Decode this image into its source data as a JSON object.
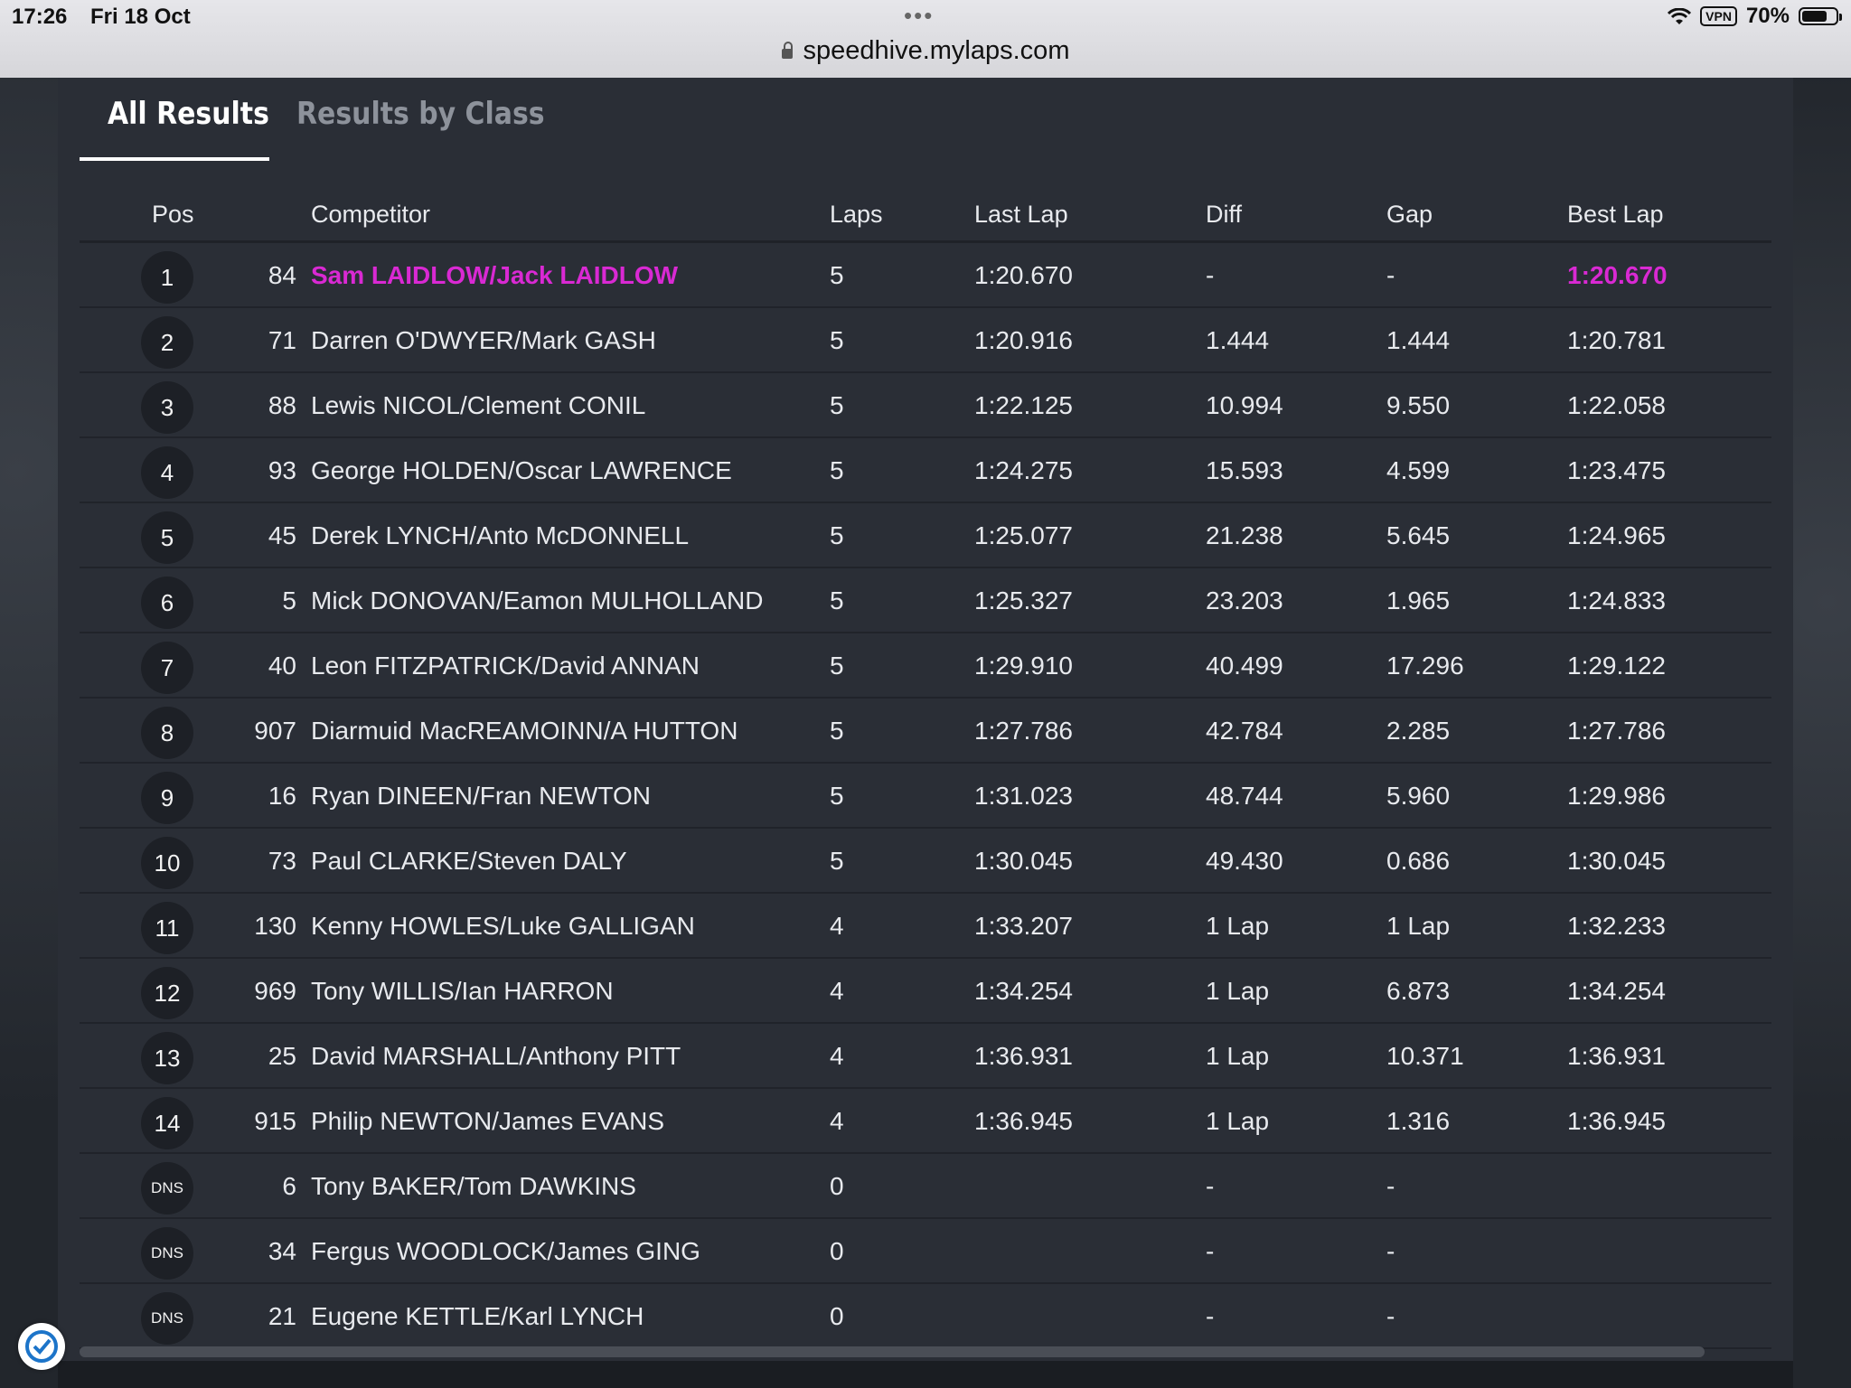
{
  "status_bar": {
    "time": "17:26",
    "date": "Fri 18 Oct",
    "url": "speedhive.mylaps.com",
    "vpn": "VPN",
    "battery": "70%"
  },
  "tabs": [
    {
      "label": "All Results",
      "active": true
    },
    {
      "label": "Results by Class",
      "active": false
    }
  ],
  "table": {
    "headers": {
      "pos": "Pos",
      "competitor": "Competitor",
      "laps": "Laps",
      "last_lap": "Last Lap",
      "diff": "Diff",
      "gap": "Gap",
      "best_lap": "Best Lap"
    },
    "highlight_color": "#d929d3",
    "rows": [
      {
        "pos": "1",
        "num": "84",
        "competitor": "Sam LAIDLOW/Jack LAIDLOW",
        "laps": "5",
        "last": "1:20.670",
        "diff": "-",
        "gap": "-",
        "best": "1:20.670",
        "highlight": true
      },
      {
        "pos": "2",
        "num": "71",
        "competitor": "Darren O'DWYER/Mark GASH",
        "laps": "5",
        "last": "1:20.916",
        "diff": "1.444",
        "gap": "1.444",
        "best": "1:20.781"
      },
      {
        "pos": "3",
        "num": "88",
        "competitor": "Lewis NICOL/Clement CONIL",
        "laps": "5",
        "last": "1:22.125",
        "diff": "10.994",
        "gap": "9.550",
        "best": "1:22.058"
      },
      {
        "pos": "4",
        "num": "93",
        "competitor": "George HOLDEN/Oscar LAWRENCE",
        "laps": "5",
        "last": "1:24.275",
        "diff": "15.593",
        "gap": "4.599",
        "best": "1:23.475"
      },
      {
        "pos": "5",
        "num": "45",
        "competitor": "Derek LYNCH/Anto McDONNELL",
        "laps": "5",
        "last": "1:25.077",
        "diff": "21.238",
        "gap": "5.645",
        "best": "1:24.965"
      },
      {
        "pos": "6",
        "num": "5",
        "competitor": "Mick DONOVAN/Eamon MULHOLLAND",
        "laps": "5",
        "last": "1:25.327",
        "diff": "23.203",
        "gap": "1.965",
        "best": "1:24.833"
      },
      {
        "pos": "7",
        "num": "40",
        "competitor": "Leon FITZPATRICK/David ANNAN",
        "laps": "5",
        "last": "1:29.910",
        "diff": "40.499",
        "gap": "17.296",
        "best": "1:29.122"
      },
      {
        "pos": "8",
        "num": "907",
        "competitor": "Diarmuid MacREAMOINN/A HUTTON",
        "laps": "5",
        "last": "1:27.786",
        "diff": "42.784",
        "gap": "2.285",
        "best": "1:27.786"
      },
      {
        "pos": "9",
        "num": "16",
        "competitor": "Ryan DINEEN/Fran NEWTON",
        "laps": "5",
        "last": "1:31.023",
        "diff": "48.744",
        "gap": "5.960",
        "best": "1:29.986"
      },
      {
        "pos": "10",
        "num": "73",
        "competitor": "Paul CLARKE/Steven DALY",
        "laps": "5",
        "last": "1:30.045",
        "diff": "49.430",
        "gap": "0.686",
        "best": "1:30.045"
      },
      {
        "pos": "11",
        "num": "130",
        "competitor": "Kenny HOWLES/Luke GALLIGAN",
        "laps": "4",
        "last": "1:33.207",
        "diff": "1 Lap",
        "gap": "1 Lap",
        "best": "1:32.233"
      },
      {
        "pos": "12",
        "num": "969",
        "competitor": "Tony WILLIS/Ian HARRON",
        "laps": "4",
        "last": "1:34.254",
        "diff": "1 Lap",
        "gap": "6.873",
        "best": "1:34.254"
      },
      {
        "pos": "13",
        "num": "25",
        "competitor": "David MARSHALL/Anthony PITT",
        "laps": "4",
        "last": "1:36.931",
        "diff": "1 Lap",
        "gap": "10.371",
        "best": "1:36.931"
      },
      {
        "pos": "14",
        "num": "915",
        "competitor": "Philip NEWTON/James EVANS",
        "laps": "4",
        "last": "1:36.945",
        "diff": "1 Lap",
        "gap": "1.316",
        "best": "1:36.945"
      },
      {
        "pos": "DNS",
        "num": "6",
        "competitor": "Tony BAKER/Tom DAWKINS",
        "laps": "0",
        "last": "",
        "diff": "-",
        "gap": "-",
        "best": ""
      },
      {
        "pos": "DNS",
        "num": "34",
        "competitor": "Fergus WOODLOCK/James GING",
        "laps": "0",
        "last": "",
        "diff": "-",
        "gap": "-",
        "best": ""
      },
      {
        "pos": "DNS",
        "num": "21",
        "competitor": "Eugene KETTLE/Karl LYNCH",
        "laps": "0",
        "last": "",
        "diff": "-",
        "gap": "-",
        "best": ""
      }
    ]
  }
}
